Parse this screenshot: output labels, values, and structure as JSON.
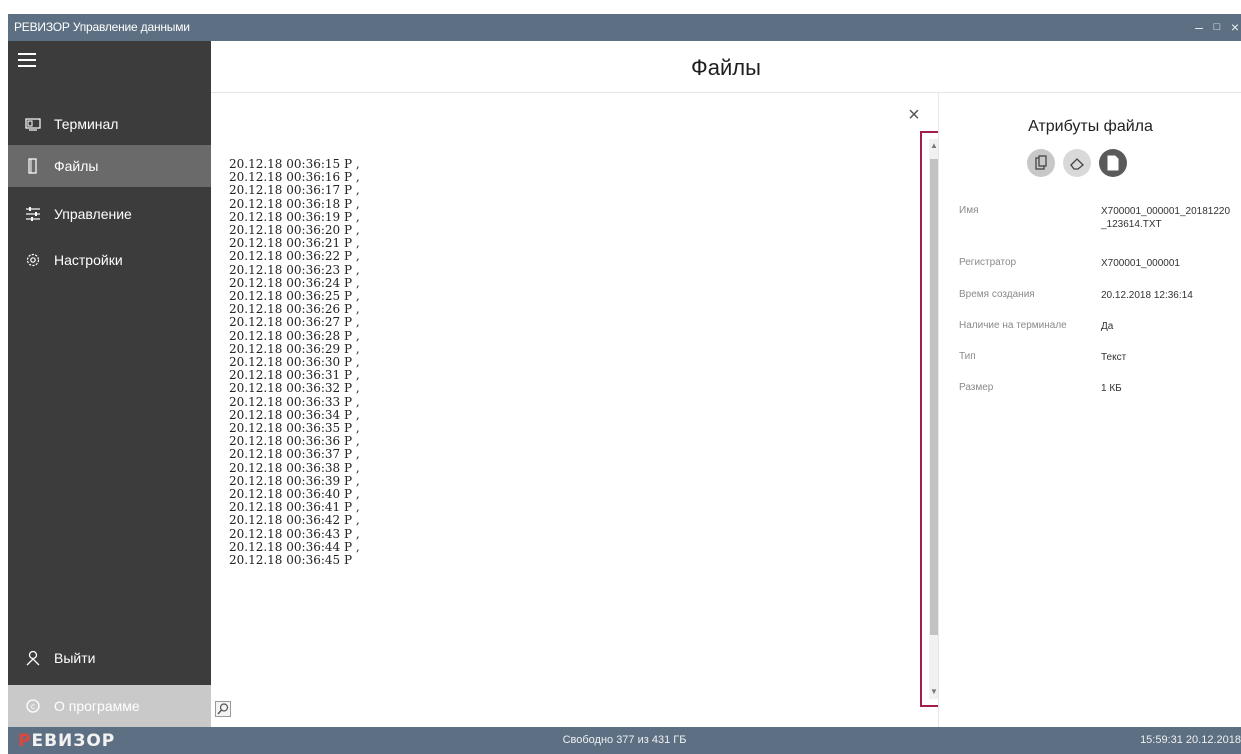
{
  "window": {
    "title": "РЕВИЗОР Управление данными",
    "minimize": "–",
    "maximize": "□",
    "close": "×"
  },
  "sidebar": {
    "items": [
      {
        "label": "Терминал",
        "icon": "terminal-icon"
      },
      {
        "label": "Файлы",
        "icon": "files-icon",
        "active": true
      },
      {
        "label": "Управление",
        "icon": "control-icon"
      },
      {
        "label": "Настройки",
        "icon": "settings-icon"
      }
    ],
    "bottom": [
      {
        "label": "Выйти",
        "icon": "user-icon"
      },
      {
        "label": "О программе",
        "icon": "about-icon"
      }
    ]
  },
  "header": {
    "title": "Файлы"
  },
  "content": {
    "close_label": "×",
    "lines": [
      "20.12.18 00:36:15 P ,",
      "20.12.18 00:36:16 P ,",
      "20.12.18 00:36:17 P ,",
      "20.12.18 00:36:18 P ,",
      "20.12.18 00:36:19 P ,",
      "20.12.18 00:36:20 P ,",
      "20.12.18 00:36:21 P ,",
      "20.12.18 00:36:22 P ,",
      "20.12.18 00:36:23 P ,",
      "20.12.18 00:36:24 P ,",
      "20.12.18 00:36:25 P ,",
      "20.12.18 00:36:26 P ,",
      "20.12.18 00:36:27 P ,",
      "20.12.18 00:36:28 P ,",
      "20.12.18 00:36:29 P ,",
      "20.12.18 00:36:30 P ,",
      "20.12.18 00:36:31 P ,",
      "20.12.18 00:36:32 P ,",
      "20.12.18 00:36:33 P ,",
      "20.12.18 00:36:34 P ,",
      "20.12.18 00:36:35 P ,",
      "20.12.18 00:36:36 P ,",
      "20.12.18 00:36:37 P ,",
      "20.12.18 00:36:38 P ,",
      "20.12.18 00:36:39 P ,",
      "20.12.18 00:36:40 P ,",
      "20.12.18 00:36:41 P ,",
      "20.12.18 00:36:42 P ,",
      "20.12.18 00:36:43 P ,",
      "20.12.18 00:36:44 P ,",
      "20.12.18 00:36:45 P"
    ]
  },
  "attributes": {
    "title": "Атрибуты файла",
    "rows": [
      {
        "key": "Имя",
        "value": "X700001_000001_20181220_123614.TXT"
      },
      {
        "key": "Регистратор",
        "value": "X700001_000001"
      },
      {
        "key": "Время создания",
        "value": "20.12.2018 12:36:14"
      },
      {
        "key": "Наличие на терминале",
        "value": "Да"
      },
      {
        "key": "Тип",
        "value": "Текст"
      },
      {
        "key": "Размер",
        "value": "1 КБ"
      }
    ]
  },
  "statusbar": {
    "logo_first": "Р",
    "logo_rest": "ЕВИЗОР",
    "free": "Свободно 377 из 431 ГБ",
    "clock": "15:59:31 20.12.2018"
  },
  "colors": {
    "titlebar": "#5d6f82",
    "sidebar": "#3c3c3c",
    "sidebar_active": "#6a6a6a",
    "highlight": "#a21f4a",
    "logo_red": "#e0463b"
  }
}
